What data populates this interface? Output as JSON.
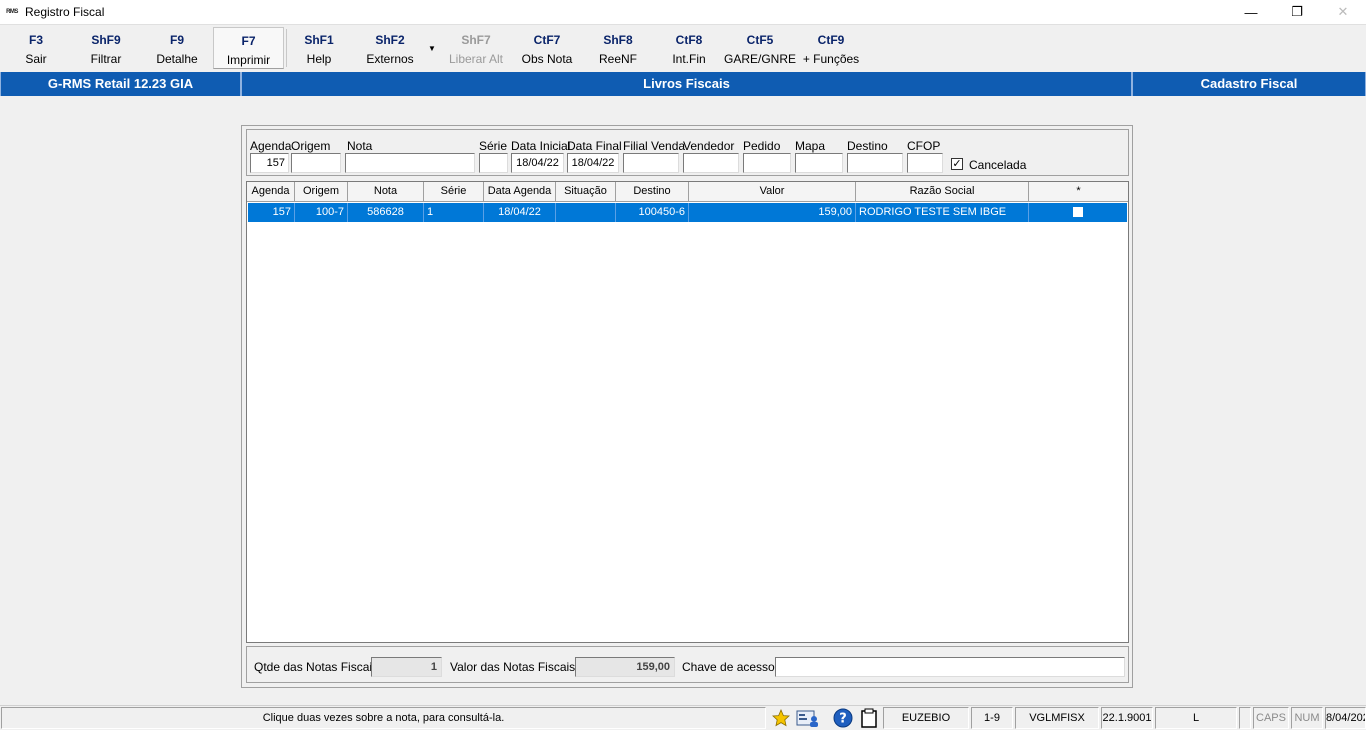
{
  "window": {
    "icon_text": "RMS",
    "title": "Registro Fiscal",
    "minimize": "—",
    "restore": "❐",
    "close": "✕"
  },
  "toolbar": {
    "items": [
      {
        "key": "F3",
        "label": "Sair"
      },
      {
        "key": "ShF9",
        "label": "Filtrar"
      },
      {
        "key": "F9",
        "label": "Detalhe"
      },
      {
        "key": "F7",
        "label": "Imprimir"
      },
      {
        "key": "ShF1",
        "label": "Help"
      },
      {
        "key": "ShF2",
        "label": "Externos"
      },
      {
        "key": "ShF7",
        "label": "Liberar Alt"
      },
      {
        "key": "CtF7",
        "label": "Obs Nota"
      },
      {
        "key": "ShF8",
        "label": "ReeNF"
      },
      {
        "key": "CtF8",
        "label": "Int.Fin"
      },
      {
        "key": "CtF5",
        "label": "GARE/GNRE"
      },
      {
        "key": "CtF9",
        "label": "+ Funções"
      }
    ]
  },
  "header": {
    "left": "G-RMS Retail 12.23 GIA",
    "center": "Livros Fiscais",
    "right": "Cadastro Fiscal"
  },
  "filters": {
    "labels": {
      "agenda": "Agenda",
      "origem": "Origem",
      "nota": "Nota",
      "serie": "Série",
      "data_inicial": "Data Inicial",
      "data_final": "Data Final",
      "filial_venda": "Filial Venda",
      "vendedor": "Vendedor",
      "pedido": "Pedido",
      "mapa": "Mapa",
      "destino": "Destino",
      "cfop": "CFOP",
      "cancelada": "Cancelada"
    },
    "values": {
      "agenda": "157",
      "origem": "",
      "nota": "",
      "serie": "",
      "data_inicial": "18/04/22",
      "data_final": "18/04/22",
      "filial_venda": "",
      "vendedor": "",
      "pedido": "",
      "mapa": "",
      "destino": "",
      "cfop": "",
      "cancelada_mark": "✓"
    }
  },
  "grid": {
    "columns": [
      "Agenda",
      "Origem",
      "Nota",
      "Série",
      "Data Agenda",
      "Situação",
      "Destino",
      "Valor",
      "Razão Social",
      "*"
    ],
    "rows": [
      {
        "agenda": "157",
        "origem": "100-7",
        "nota": "586628",
        "serie": "1",
        "data_agenda": "18/04/22",
        "situacao": "",
        "destino": "100450-6",
        "valor": "159,00",
        "razao_social": "RODRIGO TESTE SEM IBGE"
      }
    ]
  },
  "totals": {
    "qtde_label": "Qtde das Notas Fiscais:",
    "qtde_value": "1",
    "valor_label": "Valor  das Notas Fiscais:",
    "valor_value": "159,00",
    "chave_label": "Chave de acesso:",
    "chave_value": ""
  },
  "status": {
    "message": "Clique duas vezes sobre a nota, para consultá-la.",
    "user": "EUZEBIO",
    "code": "1-9",
    "program": "VGLMFISX",
    "version": "22.1.9001",
    "mode": "L",
    "caps": "CAPS",
    "num": "NUM",
    "date": "8/04/202"
  },
  "icons": [
    "star-icon",
    "profile-card-icon",
    "help-icon",
    "clipboard-icon",
    "dropdown-arrow-icon",
    "checkmark-icon"
  ],
  "colors": {
    "header_blue": "#0f5cb2",
    "selection_blue": "#0078d7",
    "toolbar_key": "#0a246a"
  }
}
